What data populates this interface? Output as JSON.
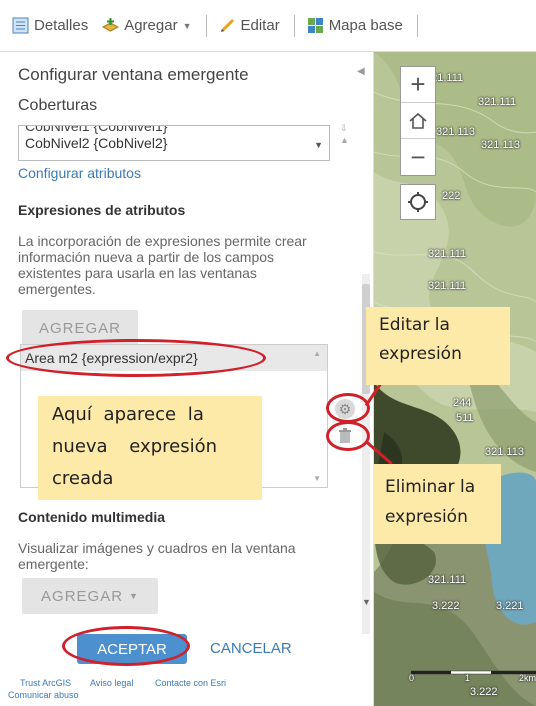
{
  "toolbar": {
    "details": "Detalles",
    "add": "Agregar",
    "edit": "Editar",
    "basemap": "Mapa base"
  },
  "panel": {
    "title": "Configurar ventana emergente",
    "layers_label": "Coberturas",
    "layer_options": [
      "CobNivel1 {CobNivel1}",
      "CobNivel2 {CobNivel2}"
    ],
    "configure_attributes": "Configurar atributos",
    "expressions_heading": "Expresiones de atributos",
    "expressions_desc": [
      "La incorporación de expresiones permite crear",
      "información nueva a partir de los campos",
      "existentes para usarla en las ventanas",
      "emergentes."
    ],
    "add_button": "AGREGAR",
    "expression_item": "Area m2 {expression/expr2}",
    "multimedia_heading": "Contenido multimedia",
    "multimedia_desc": [
      "Visualizar imágenes y cuadros en la ventana",
      "emergente:"
    ],
    "add_media_button": "AGREGAR",
    "accept": "ACEPTAR",
    "cancel": "CANCELAR"
  },
  "footer": {
    "trust": "Trust ArcGIS",
    "legal": "Aviso legal",
    "contact": "Contacte con Esri",
    "report": "Comunicar abuso"
  },
  "map": {
    "labels": [
      "321.111",
      "321.111",
      "321.113",
      "321.113",
      "222",
      "321.111",
      "321.111",
      "244",
      "511",
      "321.113",
      "321.111",
      "3.222",
      "3.221",
      "3.222",
      "0",
      "1",
      "2km"
    ]
  },
  "annotations": {
    "edit": [
      "Editar la",
      "expresión"
    ],
    "new": [
      "Aquí aparece la",
      "nueva expresión",
      "creada"
    ],
    "delete": [
      "Eliminar la",
      "expresión"
    ]
  },
  "colors": {
    "accent": "#4d90cf",
    "link": "#3a7ab9",
    "highlight_red": "#d0202a",
    "callout_bg": "#fde9a8"
  }
}
